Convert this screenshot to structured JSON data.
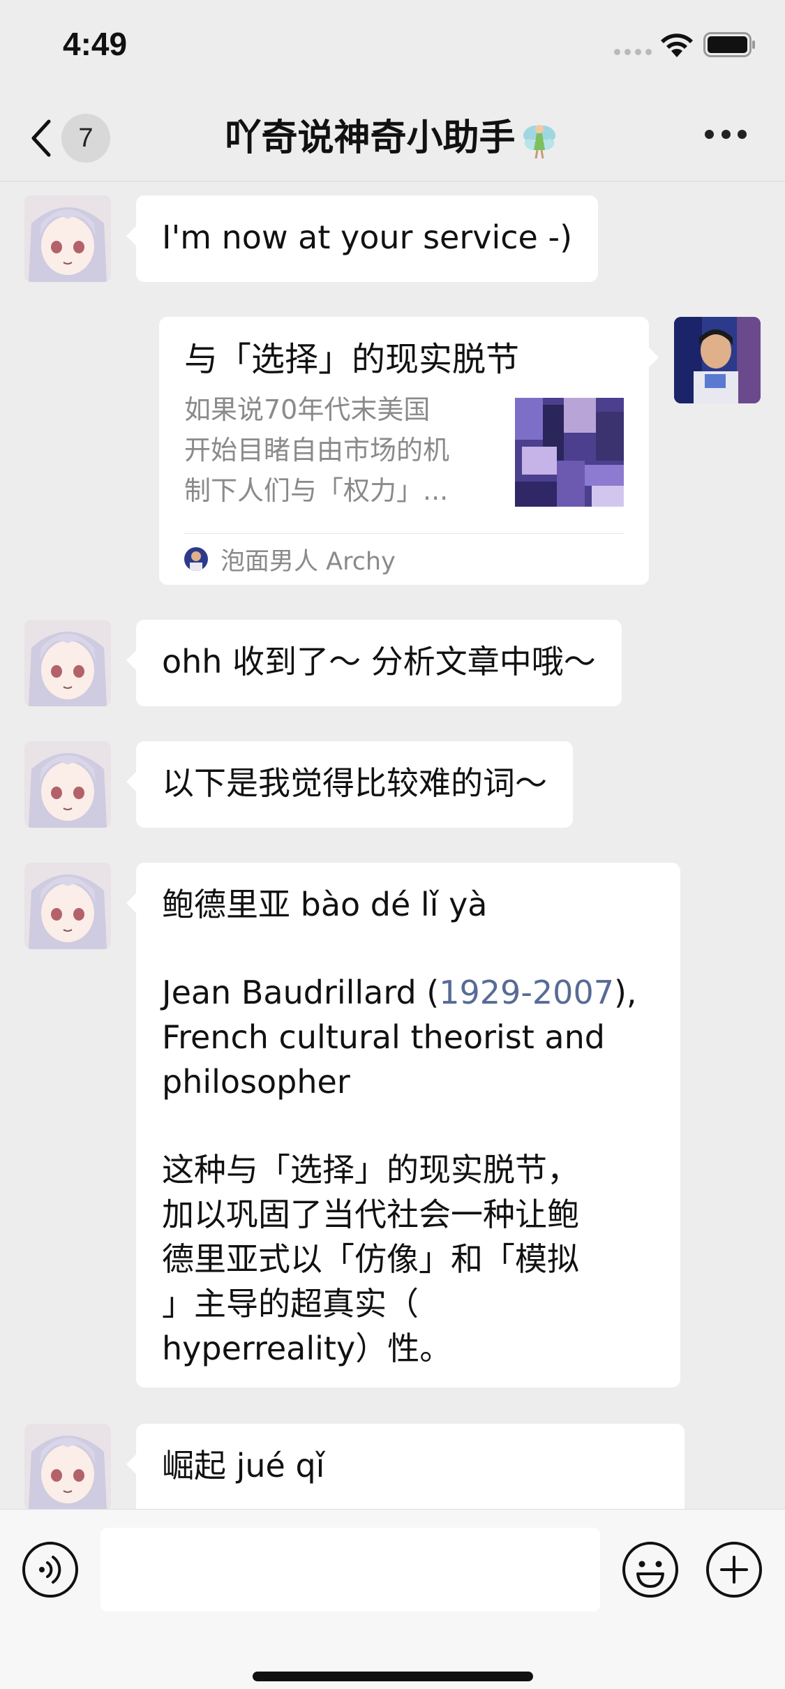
{
  "status_bar": {
    "time": "4:49"
  },
  "nav": {
    "unread_count": "7",
    "title": "吖奇说神奇小助手"
  },
  "messages": [
    {
      "side": "left",
      "text": "I'm now at your service -)"
    },
    {
      "side": "right",
      "type": "article",
      "title": "与「选择」的现实脱节",
      "summary": "如果说70年代末美国\n开始目睹自由市场的机\n制下人们与「权力」...",
      "source": "泡面男人 Archy"
    },
    {
      "side": "left",
      "text": "ohh 收到了～ 分析文章中哦～"
    },
    {
      "side": "left",
      "text": "以下是我觉得比较难的词～"
    },
    {
      "side": "left",
      "word": "鲍德里亚 bào dé lǐ yà",
      "def_before": "Jean Baudrillard (",
      "def_link": "1929-2007",
      "def_after": "),\nFrench cultural theorist and\nphilosopher",
      "example": "这种与「选择」的现实脱节，\n加以巩固了当代社会一种让鲍\n德里亚式以「仿像」和「模拟\n」主导的超真实（\nhyperreality）性。"
    },
    {
      "side": "left",
      "text": "崛起 jué qǐ"
    }
  ],
  "colors": {
    "link": "#576b95",
    "background": "#ededed",
    "bubble": "#ffffff"
  },
  "icons": [
    "back-chevron-icon",
    "fairy-icon",
    "more-dots-icon",
    "voice-icon",
    "emoji-icon",
    "plus-icon",
    "wifi-icon",
    "battery-icon"
  ]
}
